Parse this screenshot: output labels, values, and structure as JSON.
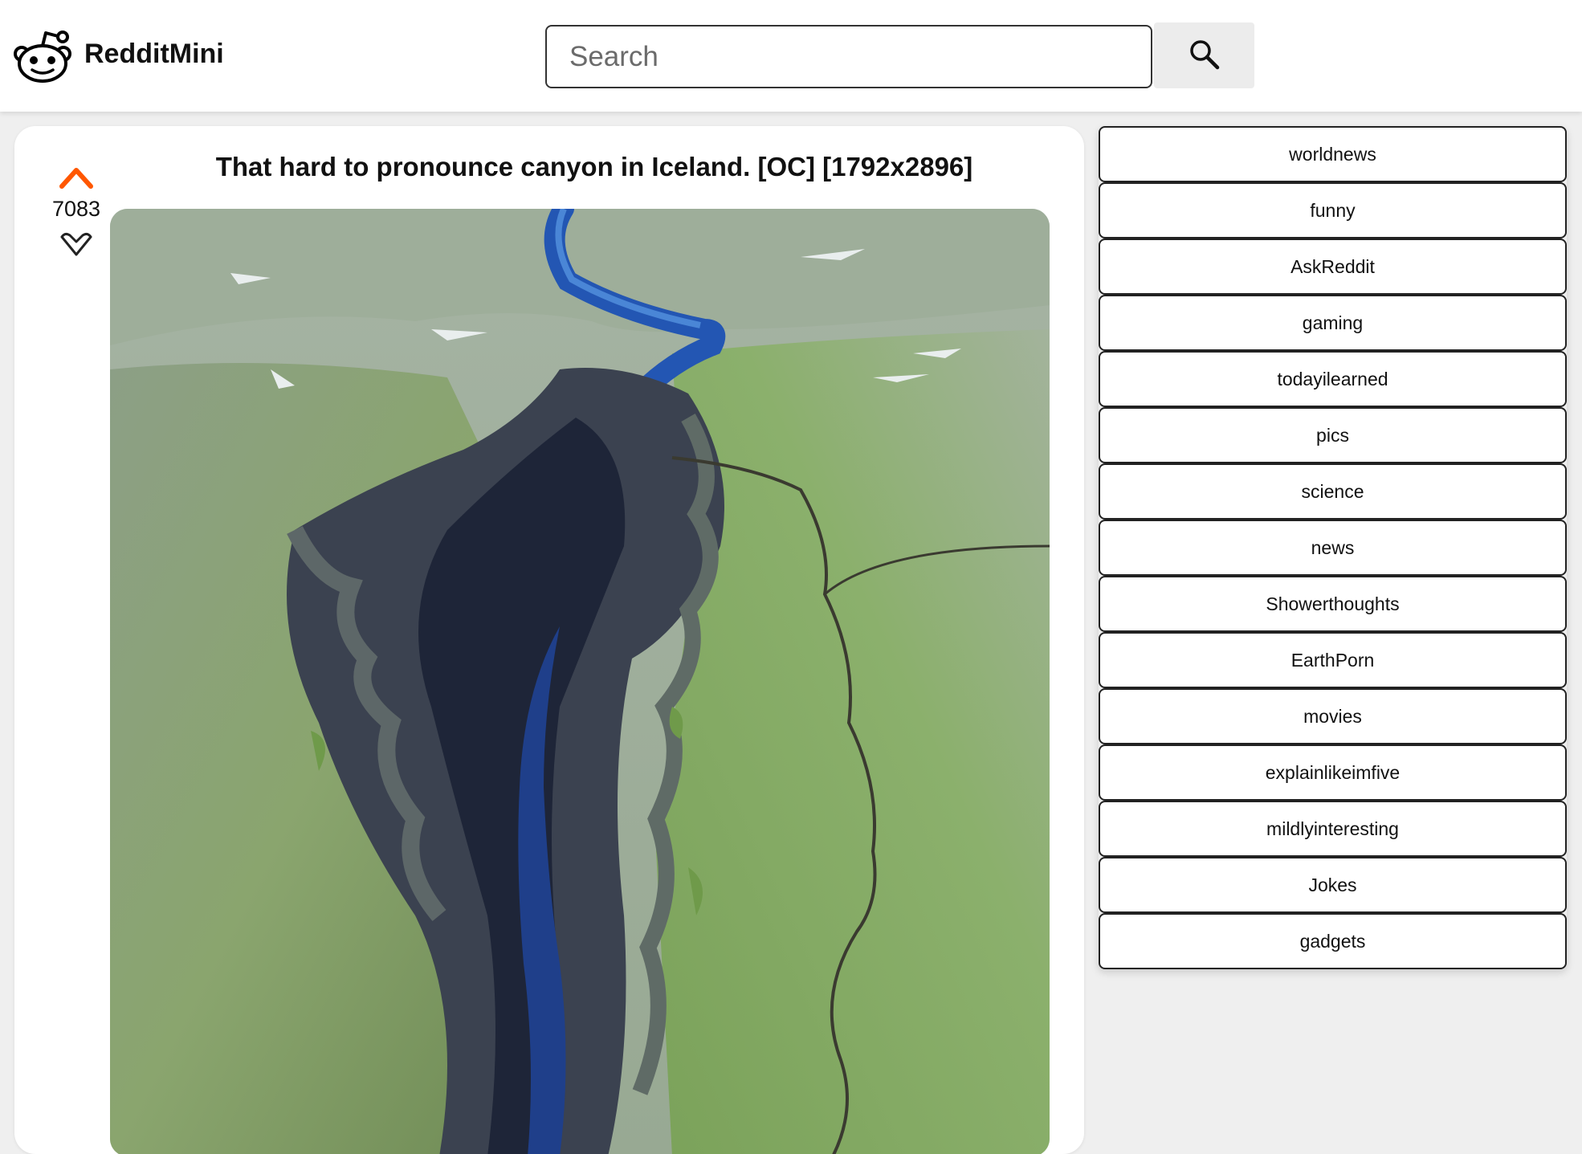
{
  "header": {
    "brand": "RedditMini",
    "search_placeholder": "Search",
    "search_value": ""
  },
  "post": {
    "title": "That hard to pronounce canyon in Iceland. [OC] [1792x2896]",
    "score": "7083",
    "upvote_color": "#ff5700"
  },
  "sidebar": {
    "subreddits": [
      "worldnews",
      "funny",
      "AskReddit",
      "gaming",
      "todayilearned",
      "pics",
      "science",
      "news",
      "Showerthoughts",
      "EarthPorn",
      "movies",
      "explainlikeimfive",
      "mildlyinteresting",
      "Jokes",
      "gadgets"
    ]
  }
}
